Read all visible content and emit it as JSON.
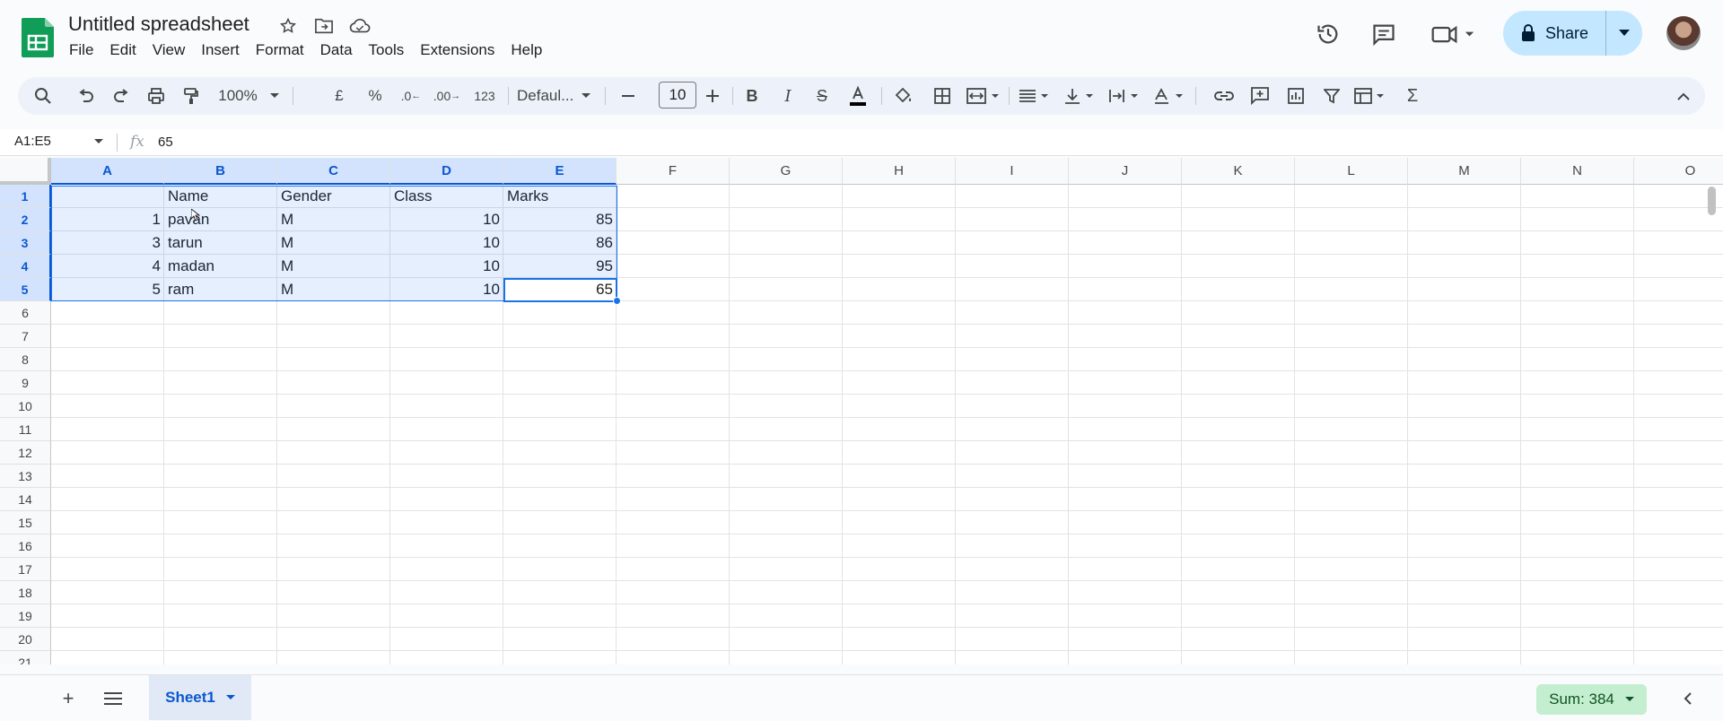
{
  "app": {
    "title": "Untitled spreadsheet",
    "brand_color": "#0f9d58"
  },
  "menu": [
    "File",
    "Edit",
    "View",
    "Insert",
    "Format",
    "Data",
    "Tools",
    "Extensions",
    "Help"
  ],
  "share": {
    "label": "Share"
  },
  "toolbar": {
    "zoom": "100%",
    "currency": "£",
    "percent": "%",
    "dec_decrease": ".0",
    "dec_increase": ".00",
    "number_format": "123",
    "font": "Defaul...",
    "font_size": "10"
  },
  "formula_bar": {
    "name_box": "A1:E5",
    "value": "65"
  },
  "columns": [
    "A",
    "B",
    "C",
    "D",
    "E",
    "F",
    "G",
    "H",
    "I",
    "J",
    "K",
    "L",
    "M",
    "N",
    "O"
  ],
  "rows": [
    "1",
    "2",
    "3",
    "4",
    "5",
    "6",
    "7",
    "8",
    "9",
    "10",
    "11",
    "12",
    "13",
    "14",
    "15",
    "16",
    "17",
    "18",
    "19",
    "20",
    "21"
  ],
  "cells": {
    "header": [
      "",
      "Name",
      "Gender",
      "Class",
      "Marks"
    ],
    "data": [
      [
        "1",
        "pavan",
        "M",
        "10",
        "85"
      ],
      [
        "3",
        "tarun",
        "M",
        "10",
        "86"
      ],
      [
        "4",
        "madan",
        "M",
        "10",
        "95"
      ],
      [
        "5",
        "ram",
        "M",
        "10",
        "65"
      ]
    ]
  },
  "bottom": {
    "sheet_name": "Sheet1",
    "sum_label": "Sum: 384"
  }
}
